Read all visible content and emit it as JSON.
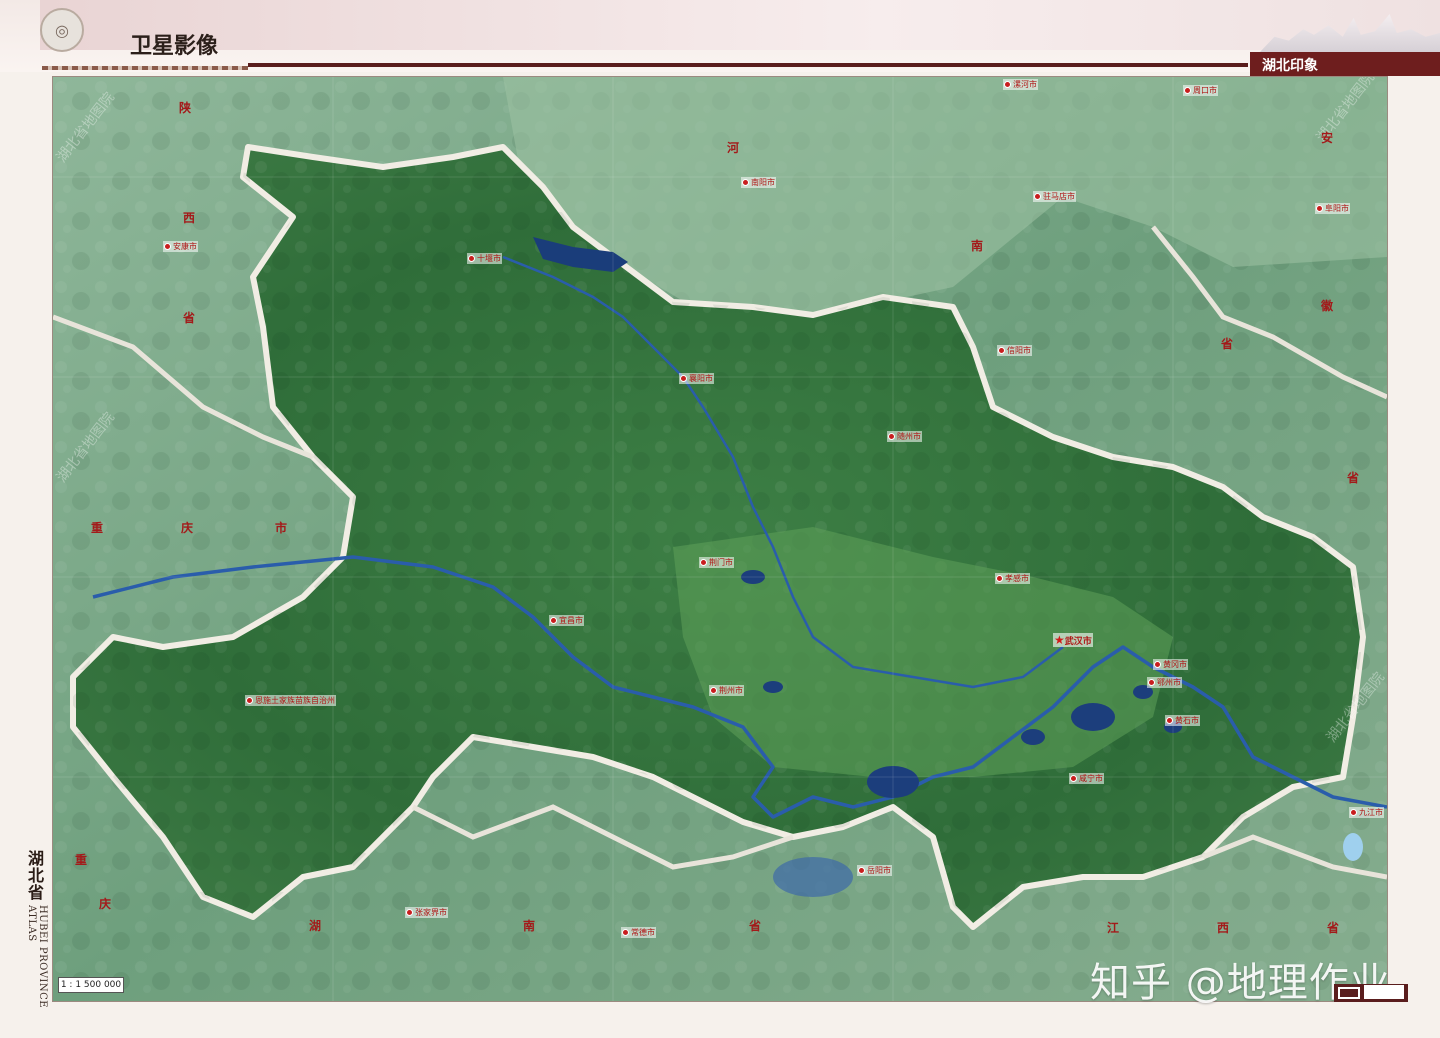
{
  "header": {
    "title": "卫星影像",
    "section": "湖北印象",
    "logo_icon": "atlas-emblem-icon"
  },
  "spine": {
    "title_cn": "湖北省",
    "title_en": "HUBEI PROVINCE ATLAS"
  },
  "map": {
    "scale": "1 : 1 500 000",
    "capital": "武汉市",
    "cities": [
      {
        "name": "十堰市"
      },
      {
        "name": "襄阳市"
      },
      {
        "name": "随州市"
      },
      {
        "name": "孝感市"
      },
      {
        "name": "荆门市"
      },
      {
        "name": "宜昌市"
      },
      {
        "name": "荆州市"
      },
      {
        "name": "黄冈市"
      },
      {
        "name": "鄂州市"
      },
      {
        "name": "黄石市"
      },
      {
        "name": "咸宁市"
      },
      {
        "name": "恩施土家族苗族自治州"
      },
      {
        "name": "安康市"
      },
      {
        "name": "南阳市"
      },
      {
        "name": "驻马店市"
      },
      {
        "name": "信阳市"
      },
      {
        "name": "阜阳市"
      },
      {
        "name": "岳阳市"
      },
      {
        "name": "常德市"
      },
      {
        "name": "张家界市"
      },
      {
        "name": "九江市"
      },
      {
        "name": "漯河市"
      },
      {
        "name": "周口市"
      }
    ],
    "provinces": [
      "陕",
      "西",
      "省",
      "河",
      "南",
      "省",
      "安",
      "徽",
      "省",
      "重",
      "庆",
      "市",
      "重",
      "庆",
      "湖",
      "南",
      "省",
      "江",
      "西",
      "省"
    ]
  },
  "watermark": "知乎 @地理作业",
  "watermark_diag": "湖北省地图院",
  "colors": {
    "brand": "#5a1d1d",
    "border": "#f1ede4",
    "city": "#b01616"
  }
}
